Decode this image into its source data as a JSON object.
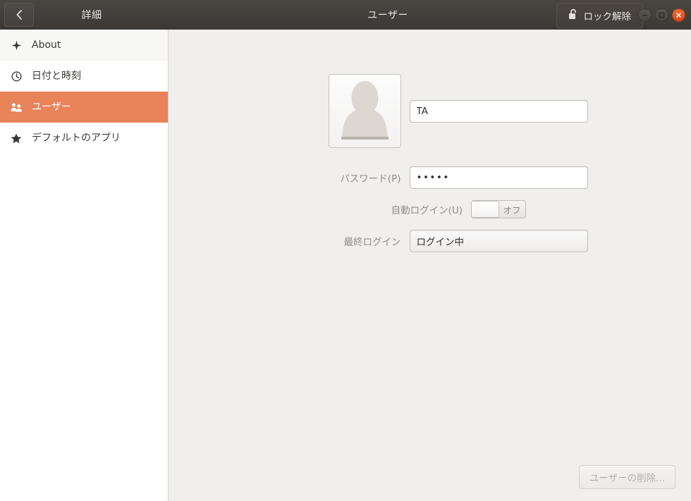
{
  "titlebar": {
    "back_icon": "chevron-left-icon",
    "panel_title": "詳細",
    "window_title": "ユーザー",
    "unlock_label": "ロック解除",
    "unlock_icon": "open-padlock-icon",
    "minimize_icon": "minimize-icon",
    "maximize_icon": "maximize-icon",
    "close_icon": "close-icon",
    "close_color": "#dd4814",
    "bg_color": "#413d3a"
  },
  "sidebar": {
    "accent_color": "#e8835a",
    "items": [
      {
        "label": "About",
        "icon": "sparkle-icon",
        "selected": false
      },
      {
        "label": "日付と時刻",
        "icon": "clock-icon",
        "selected": false
      },
      {
        "label": "ユーザー",
        "icon": "users-icon",
        "selected": true
      },
      {
        "label": "デフォルトのアプリ",
        "icon": "star-icon",
        "selected": false
      }
    ]
  },
  "main": {
    "avatar_icon": "user-avatar-placeholder",
    "name_value": "TA",
    "fields": [
      {
        "label": "パスワード(P)",
        "value": "•••••",
        "type": "password"
      },
      {
        "label": "自動ログイン(U)",
        "value": "オフ",
        "type": "toggle"
      },
      {
        "label": "最終ログイン",
        "value": "ログイン中",
        "type": "readonly"
      }
    ],
    "delete_button_label": "ユーザーの削除...",
    "background_color": "#f0efee"
  }
}
